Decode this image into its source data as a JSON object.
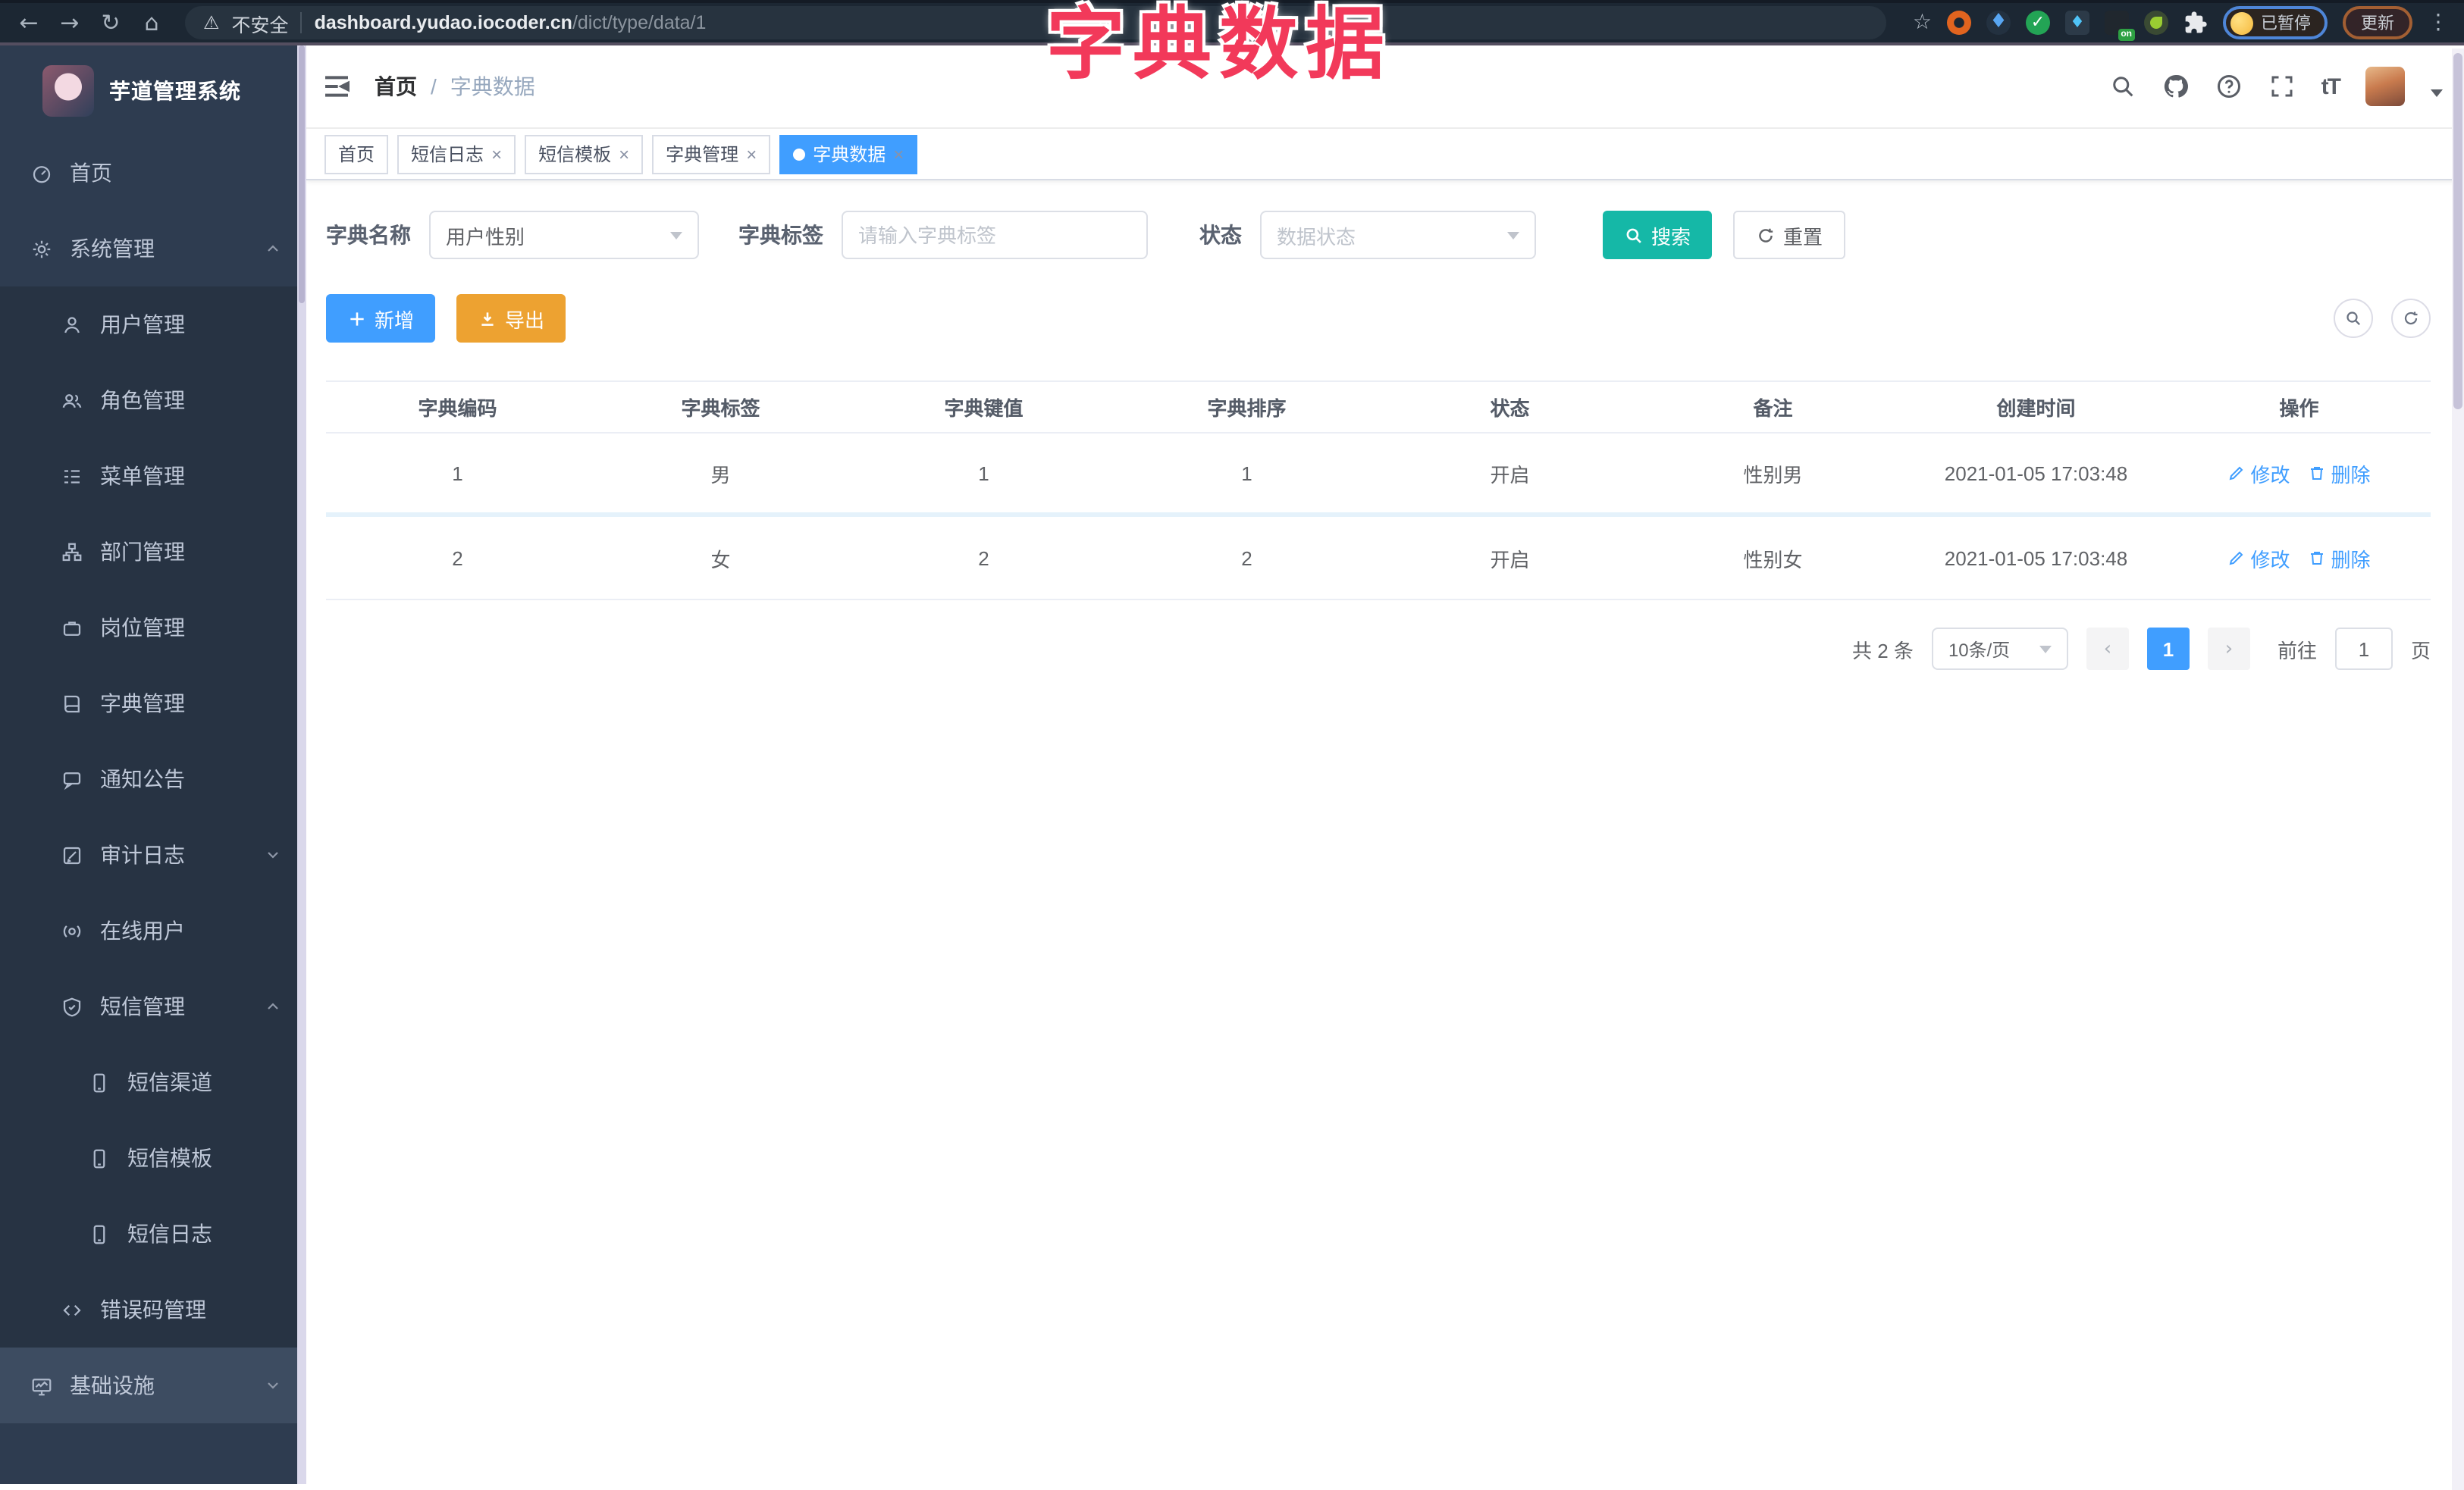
{
  "browser": {
    "security_label": "不安全",
    "url_domain": "dashboard.yudao.iocoder.cn",
    "url_path": "/dict/type/data/1",
    "ext_on_badge": "on",
    "profile_paused_label": "已暂停",
    "update_label": "更新"
  },
  "overlay_title": "字典数据",
  "sidebar": {
    "title": "芋道管理系统",
    "items": [
      {
        "label": "首页"
      },
      {
        "label": "系统管理"
      },
      {
        "label": "用户管理"
      },
      {
        "label": "角色管理"
      },
      {
        "label": "菜单管理"
      },
      {
        "label": "部门管理"
      },
      {
        "label": "岗位管理"
      },
      {
        "label": "字典管理"
      },
      {
        "label": "通知公告"
      },
      {
        "label": "审计日志"
      },
      {
        "label": "在线用户"
      },
      {
        "label": "短信管理"
      },
      {
        "label": "短信渠道"
      },
      {
        "label": "短信模板"
      },
      {
        "label": "短信日志"
      },
      {
        "label": "错误码管理"
      },
      {
        "label": "基础设施"
      }
    ]
  },
  "navbar": {
    "breadcrumb": {
      "home": "首页",
      "current": "字典数据"
    },
    "font_size_icon_text": "tT"
  },
  "tabs": {
    "items": [
      {
        "label": "首页"
      },
      {
        "label": "短信日志"
      },
      {
        "label": "短信模板"
      },
      {
        "label": "字典管理"
      },
      {
        "label": "字典数据"
      }
    ]
  },
  "filter": {
    "name_label": "字典名称",
    "name_value": "用户性别",
    "tag_label": "字典标签",
    "tag_placeholder": "请输入字典标签",
    "status_label": "状态",
    "status_placeholder": "数据状态",
    "search_label": "搜索",
    "reset_label": "重置"
  },
  "toolbar": {
    "add_label": "新增",
    "export_label": "导出"
  },
  "table": {
    "headers": [
      "字典编码",
      "字典标签",
      "字典键值",
      "字典排序",
      "状态",
      "备注",
      "创建时间",
      "操作"
    ],
    "rows": [
      {
        "code": "1",
        "label": "男",
        "value": "1",
        "sort": "1",
        "status": "开启",
        "remark": "性别男",
        "created": "2021-01-05 17:03:48"
      },
      {
        "code": "2",
        "label": "女",
        "value": "2",
        "sort": "2",
        "status": "开启",
        "remark": "性别女",
        "created": "2021-01-05 17:03:48"
      }
    ],
    "edit_label": "修改",
    "delete_label": "删除"
  },
  "pagination": {
    "total_label": "共 2 条",
    "page_size": "10条/页",
    "current_page": "1",
    "goto_label": "前往",
    "goto_value": "1",
    "page_unit": "页"
  },
  "colors": {
    "primary": "#409eff",
    "search_teal": "#15b8a7",
    "export_orange": "#eda231",
    "sidebar_bg": "#2e3c50",
    "overlay_pink": "#f2395a"
  }
}
